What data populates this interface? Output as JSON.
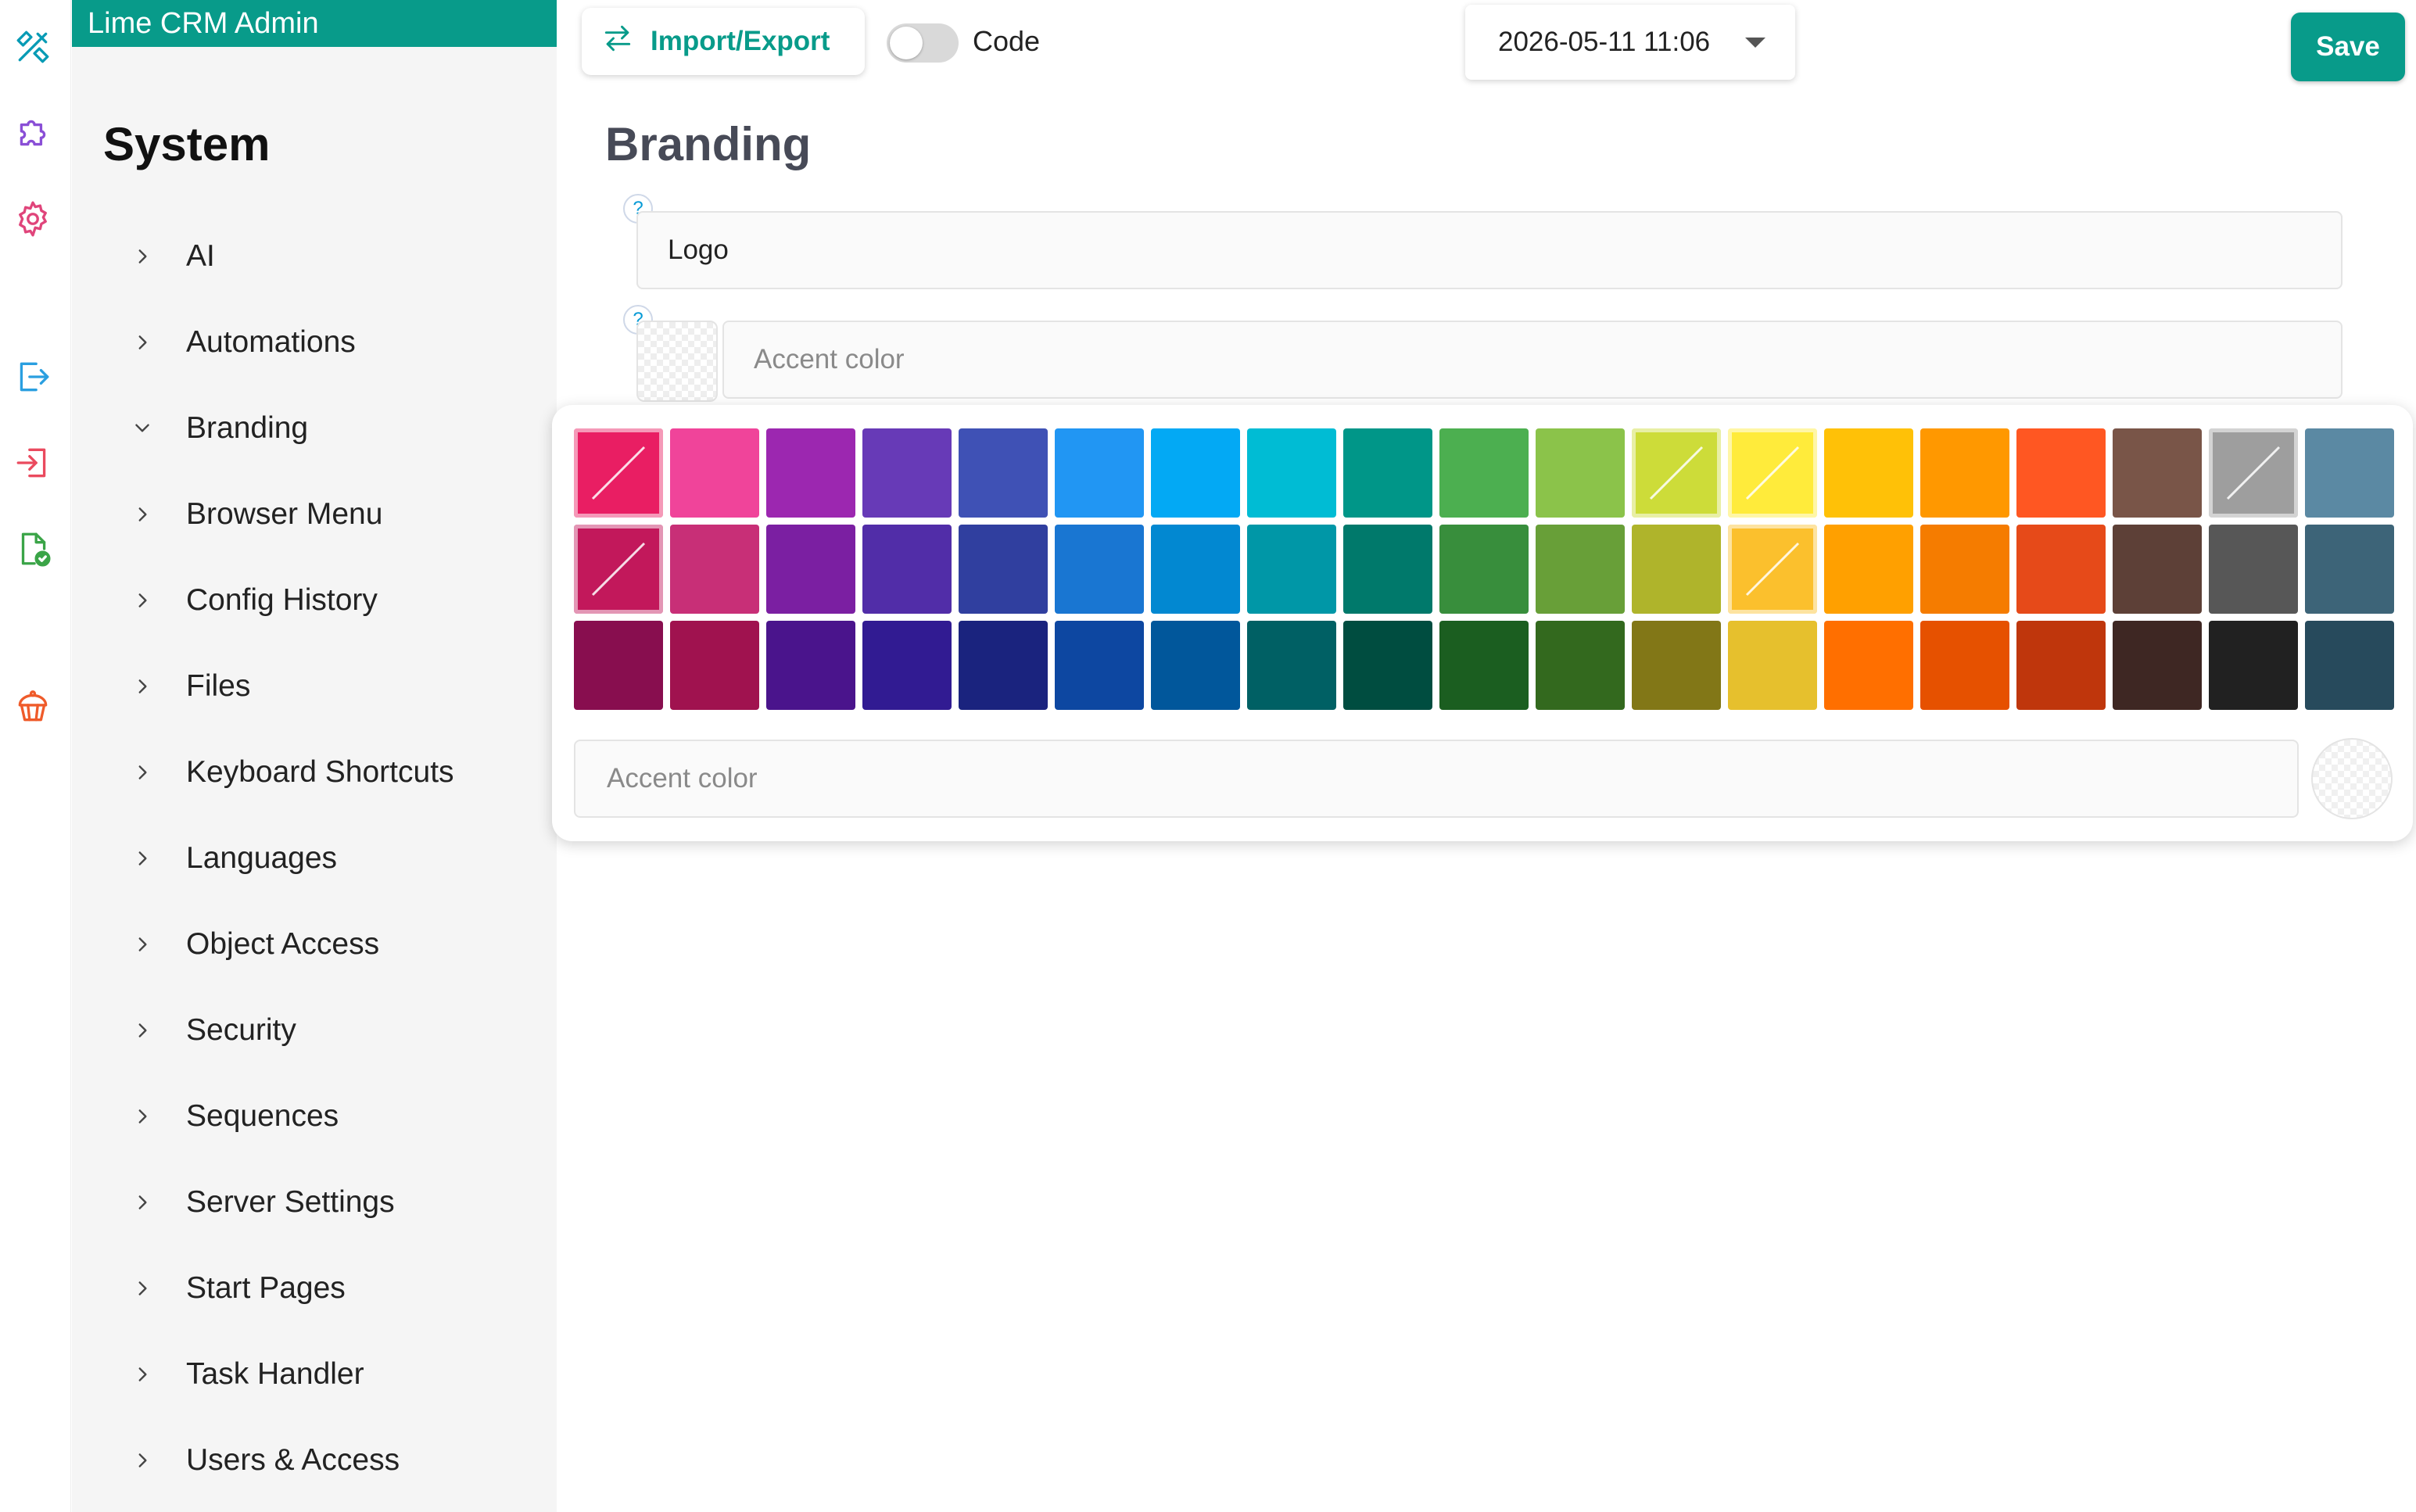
{
  "app": {
    "title": "Lime CRM Admin"
  },
  "rail": {
    "icons": [
      "tools-icon",
      "puzzle-icon",
      "gear-icon",
      "sign-out-icon",
      "sign-in-icon",
      "file-check-icon",
      "cupcake-icon"
    ]
  },
  "sidebar": {
    "heading": "System",
    "items": [
      {
        "label": "AI",
        "expanded": false
      },
      {
        "label": "Automations",
        "expanded": false
      },
      {
        "label": "Branding",
        "expanded": true
      },
      {
        "label": "Browser Menu",
        "expanded": false
      },
      {
        "label": "Config History",
        "expanded": false
      },
      {
        "label": "Files",
        "expanded": false
      },
      {
        "label": "Keyboard Shortcuts",
        "expanded": false
      },
      {
        "label": "Languages",
        "expanded": false
      },
      {
        "label": "Object Access",
        "expanded": false
      },
      {
        "label": "Security",
        "expanded": false
      },
      {
        "label": "Sequences",
        "expanded": false
      },
      {
        "label": "Server Settings",
        "expanded": false
      },
      {
        "label": "Start Pages",
        "expanded": false
      },
      {
        "label": "Task Handler",
        "expanded": false
      },
      {
        "label": "Users & Access",
        "expanded": false
      }
    ]
  },
  "toolbar": {
    "import_export_label": "Import/Export",
    "code_label": "Code",
    "code_enabled": false,
    "date_value": "2026-05-11 11:06",
    "save_label": "Save"
  },
  "main": {
    "title": "Branding",
    "help_glyph": "?",
    "logo_value": "Logo",
    "accent_placeholder": "Accent color"
  },
  "palette": {
    "input_placeholder": "Accent color",
    "colors": [
      [
        "#e91e63",
        "#f0449a",
        "#9c27b0",
        "#673ab7",
        "#3f51b5",
        "#2196f3",
        "#03a9f4",
        "#00bcd4",
        "#009688",
        "#4caf50",
        "#8bc34a",
        "#cddc39",
        "#ffeb3b",
        "#ffc107",
        "#ff9800",
        "#ff5722",
        "#795548",
        "#9e9e9e",
        "#5b89a3"
      ],
      [
        "#c2185b",
        "#c82f77",
        "#7b1fa2",
        "#512da8",
        "#303f9f",
        "#1976d2",
        "#0288d1",
        "#0097a7",
        "#00796b",
        "#388e3c",
        "#689f38",
        "#afb42b",
        "#fbc02d",
        "#ffa000",
        "#f57c00",
        "#e64a19",
        "#5d4037",
        "#575757",
        "#3d6478"
      ],
      [
        "#880e4f",
        "#a0124f",
        "#4a148c",
        "#311b92",
        "#1a237e",
        "#0d47a1",
        "#01579b",
        "#006064",
        "#004d40",
        "#1b5e20",
        "#33691e",
        "#827717",
        "#e6c02d",
        "#ff6f00",
        "#e65100",
        "#bf360c",
        "#3e2723",
        "#212121",
        "#274a5c"
      ]
    ],
    "crossed": [
      [
        0,
        0
      ],
      [
        0,
        11
      ],
      [
        0,
        12
      ],
      [
        0,
        17
      ],
      [
        1,
        0
      ],
      [
        1,
        12
      ]
    ]
  }
}
